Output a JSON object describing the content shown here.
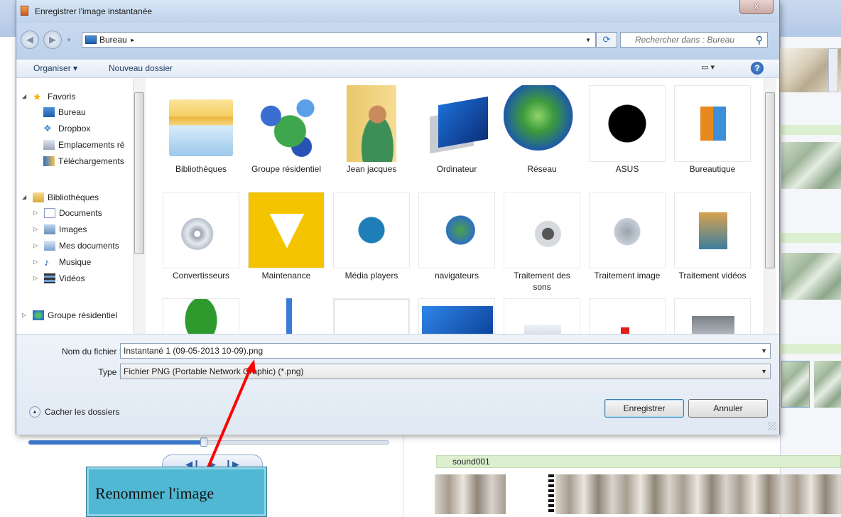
{
  "dialog": {
    "title": "Enregistrer l'image instantanée",
    "close_label": "X"
  },
  "address": {
    "breadcrumb": "Bureau",
    "separator": "►",
    "search_placeholder": "Rechercher dans : Bureau"
  },
  "toolbar": {
    "organize_label": "Organiser ▾",
    "new_folder_label": "Nouveau dossier"
  },
  "nav": {
    "favorites_header": "Favoris",
    "favorites": [
      "Bureau",
      "Dropbox",
      "Emplacements ré",
      "Téléchargements"
    ],
    "libraries_header": "Bibliothèques",
    "libraries": [
      "Documents",
      "Images",
      "Mes documents",
      "Musique",
      "Vidéos"
    ],
    "homegroup": "Groupe résidentiel"
  },
  "files": [
    {
      "label": "Bibliothèques",
      "icon": "library-folder-icon"
    },
    {
      "label": "Groupe résidentiel",
      "icon": "homegroup-icon"
    },
    {
      "label": "Jean jacques",
      "icon": "user-folder-icon"
    },
    {
      "label": "Ordinateur",
      "icon": "computer-icon"
    },
    {
      "label": "Réseau",
      "icon": "network-globe-icon"
    },
    {
      "label": "ASUS",
      "icon": "asus-logo-icon"
    },
    {
      "label": "Bureautique",
      "icon": "office-icon"
    },
    {
      "label": "Convertisseurs",
      "icon": "cd-music-icon"
    },
    {
      "label": "Maintenance",
      "icon": "warning-icon"
    },
    {
      "label": "Média players",
      "icon": "media-player-icon"
    },
    {
      "label": "navigateurs",
      "icon": "globe-arrow-icon"
    },
    {
      "label": "Traitement des sons",
      "icon": "speaker-icon"
    },
    {
      "label": "Traitement image",
      "icon": "camera-icon"
    },
    {
      "label": "Traitement vidéos",
      "icon": "film-icon"
    },
    {
      "label": "",
      "icon": "green-blob-icon"
    },
    {
      "label": "",
      "icon": "note-icon"
    },
    {
      "label": "",
      "icon": "screen-icon"
    },
    {
      "label": "",
      "icon": "monitor-icon"
    },
    {
      "label": "",
      "icon": "visa-card-icon"
    },
    {
      "label": "",
      "icon": "document-red-icon"
    },
    {
      "label": "",
      "icon": "image-gray-icon"
    }
  ],
  "form": {
    "filename_label": "Nom du fichier :",
    "filename_value": "Instantané 1 (09-05-2013 10-09).png",
    "type_label": "Type :",
    "type_value": "Fichier PNG (Portable Network Graphic) (*.png)"
  },
  "footer": {
    "hide_folders_label": "Cacher les dossiers",
    "save_label": "Enregistrer",
    "cancel_label": "Annuler"
  },
  "background": {
    "sound_track_label": "sound001",
    "callout_text": "Renommer l'image"
  },
  "colors": {
    "callout_bg": "#51b8d3",
    "arrow": "#ff0000",
    "track_green": "#dcefcf"
  }
}
